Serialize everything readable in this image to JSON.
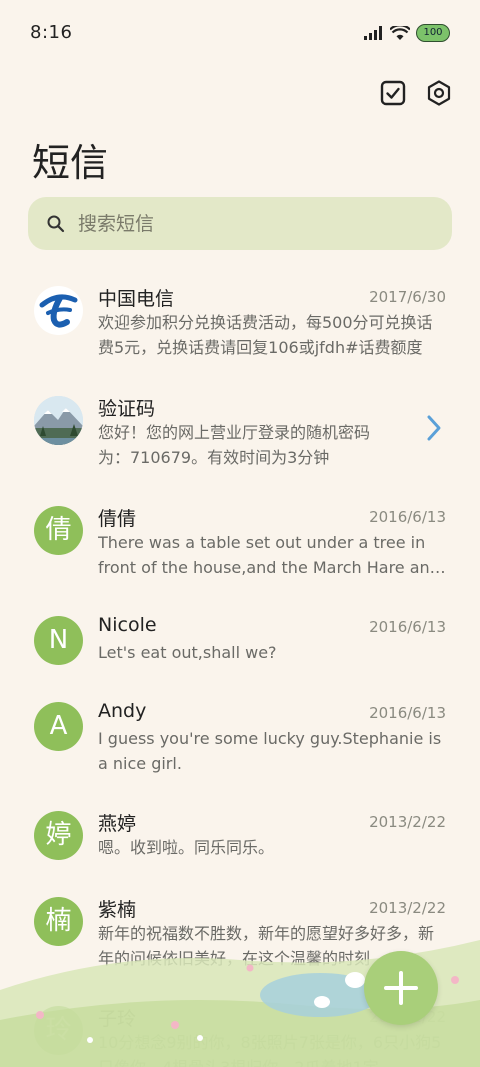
{
  "status_bar": {
    "time": "8:16",
    "battery": "100"
  },
  "page_title": "短信",
  "search": {
    "placeholder": "搜索短信"
  },
  "colors": {
    "background": "#faf4ec",
    "accent": "#8fbf5a",
    "search_bg": "#e3e8c8",
    "chevron": "#5aa0d8"
  },
  "messages": [
    {
      "name": "中国电信",
      "date": "2017/6/30",
      "preview": "欢迎参加积分兑换话费活动，每500分可兑换话费5元，兑换话费请回复106或jfdh#话费额度",
      "avatar": "",
      "avatar_icon": "china-telecom-logo-icon"
    },
    {
      "name": "验证码",
      "date": "",
      "preview": "您好！您的网上营业厅登录的随机密码为：710679。有效时间为3分钟",
      "avatar": "",
      "avatar_icon": "landscape-photo-icon"
    },
    {
      "name": "倩倩",
      "date": "2016/6/13",
      "preview": "There was a table set out under a tree in front of the house,and the March Hare and the Hatter",
      "avatar": "倩"
    },
    {
      "name": "Nicole",
      "date": "2016/6/13",
      "preview": "Let's eat out,shall we?",
      "avatar": "N"
    },
    {
      "name": "Andy",
      "date": "2016/6/13",
      "preview": "I guess you're some lucky guy.Stephanie is a nice girl.",
      "avatar": "A"
    },
    {
      "name": "燕婷",
      "date": "2013/2/22",
      "preview": "嗯。收到啦。同乐同乐。",
      "avatar": "婷"
    },
    {
      "name": "紫楠",
      "date": "2013/2/22",
      "preview": "新年的祝福数不胜数，新年的愿望好多好多，新年的问候依旧美好，在这个温馨的时刻",
      "avatar": "楠"
    },
    {
      "name": "子玲",
      "date": "2013/2/22",
      "preview": "10分想念9别的你，8张照片7张是你，6只小狗5只像你，4根骨头3根归你，2爪着地1定",
      "avatar": "玲"
    }
  ]
}
